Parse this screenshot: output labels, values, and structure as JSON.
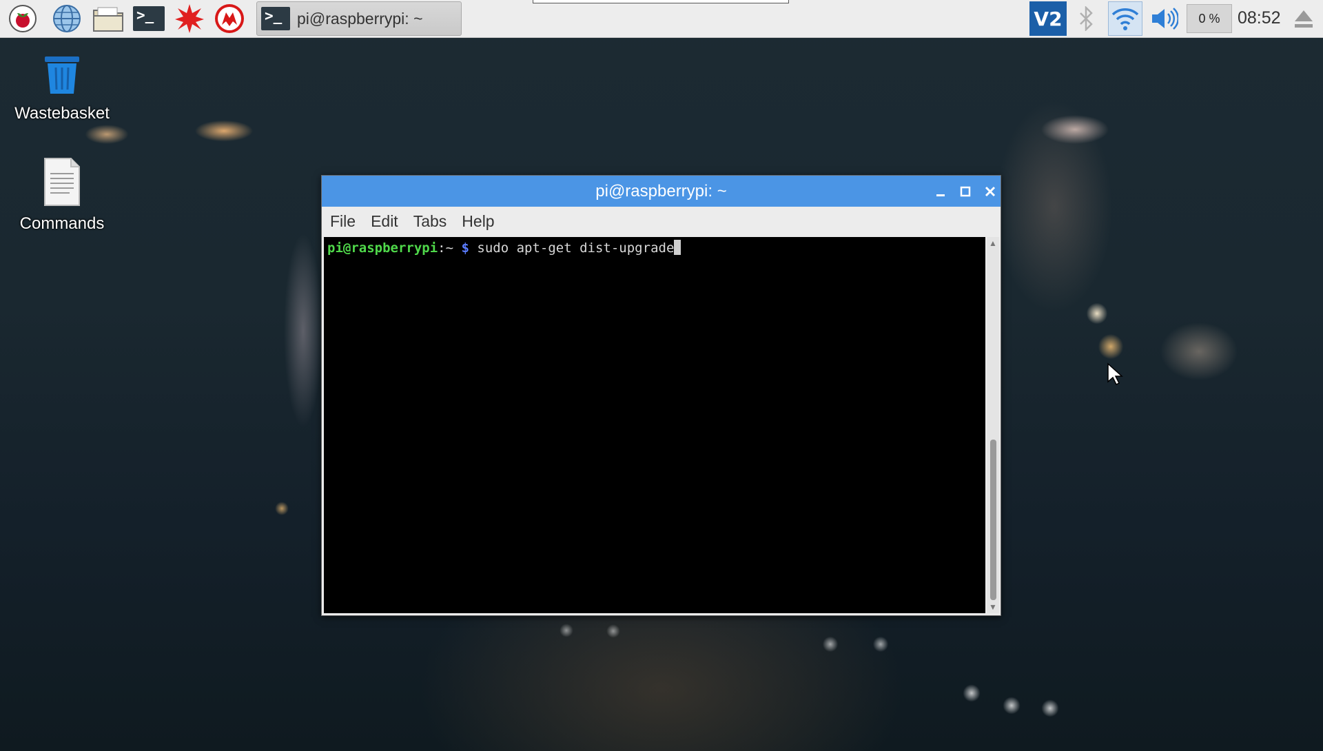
{
  "panel": {
    "launchers": [
      "raspberry-menu-icon",
      "web-browser-icon",
      "file-manager-icon",
      "terminal-icon",
      "mathematica-icon",
      "wolfram-icon"
    ],
    "task": {
      "label": "pi@raspberrypi: ~"
    },
    "tray": {
      "cpu": "0 %",
      "clock": "08:52"
    }
  },
  "desktop": {
    "icons": [
      {
        "label": "Wastebasket"
      },
      {
        "label": "Commands"
      }
    ]
  },
  "window": {
    "title": "pi@raspberrypi: ~",
    "menu": [
      "File",
      "Edit",
      "Tabs",
      "Help"
    ],
    "terminal": {
      "user_host": "pi@raspberrypi",
      "path": ":~",
      "prompt_symbol": "$",
      "command": "sudo apt-get dist-upgrade"
    }
  },
  "colors": {
    "titlebar": "#4b95e5",
    "prompt_user": "#4fd84a",
    "prompt_path": "#5a7cff"
  }
}
